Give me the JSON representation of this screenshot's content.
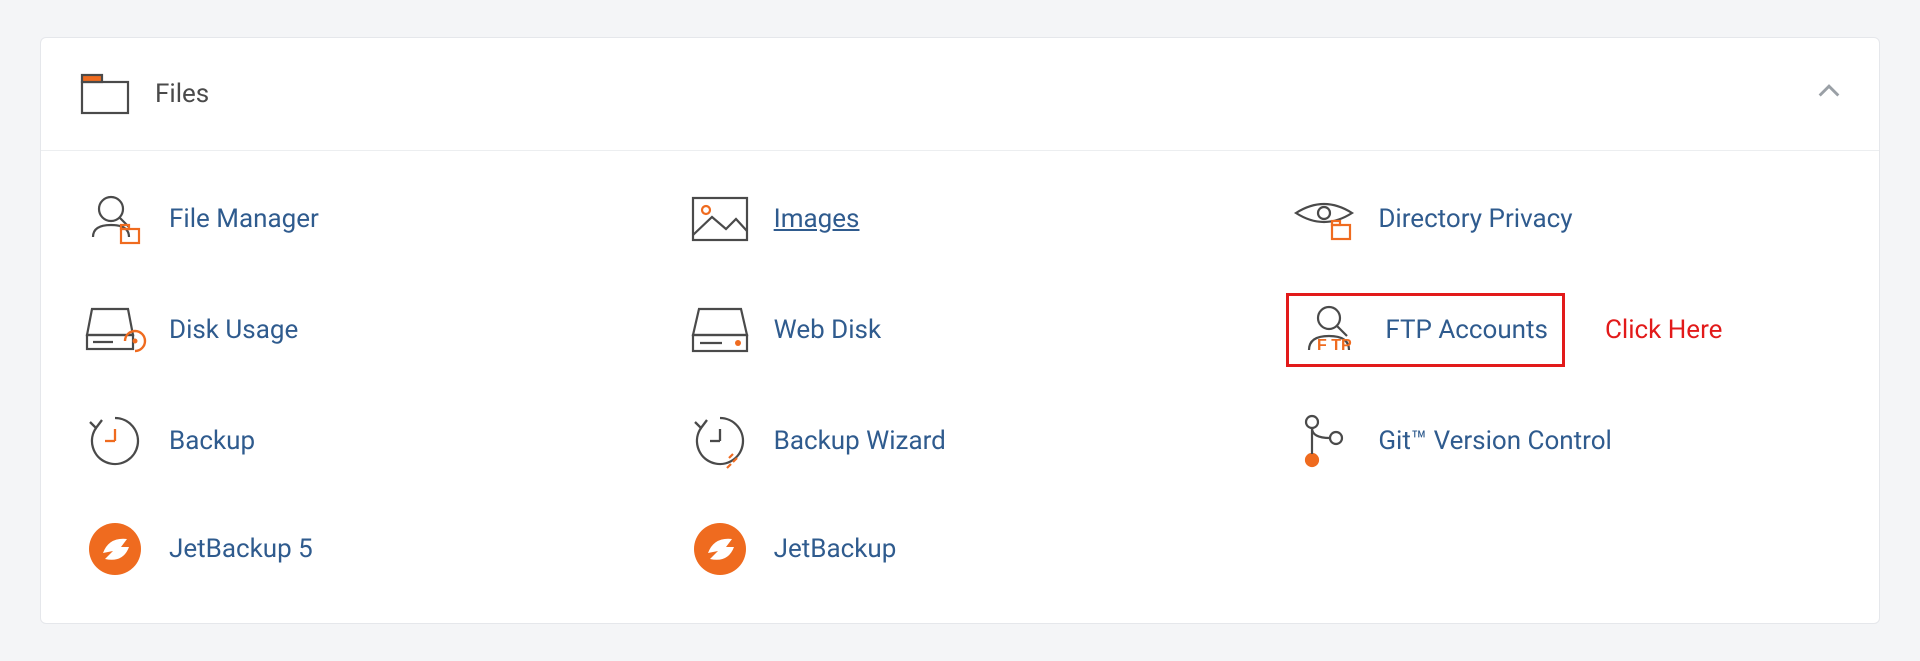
{
  "panel": {
    "title": "Files"
  },
  "items": {
    "file_manager": {
      "label": "File Manager",
      "highlighted": false,
      "underline": false
    },
    "images": {
      "label": "Images",
      "highlighted": false,
      "underline": true
    },
    "directory_privacy": {
      "label": "Directory Privacy",
      "highlighted": false,
      "underline": false
    },
    "disk_usage": {
      "label": "Disk Usage",
      "highlighted": false,
      "underline": false
    },
    "web_disk": {
      "label": "Web Disk",
      "highlighted": false,
      "underline": false
    },
    "ftp_accounts": {
      "label": "FTP Accounts",
      "highlighted": true,
      "underline": false
    },
    "backup": {
      "label": "Backup",
      "highlighted": false,
      "underline": false
    },
    "backup_wizard": {
      "label": "Backup Wizard",
      "highlighted": false,
      "underline": false
    },
    "git": {
      "label": "Git™ Version Control",
      "highlighted": false,
      "underline": false
    },
    "jetbackup5": {
      "label": "JetBackup 5",
      "highlighted": false,
      "underline": false
    },
    "jetbackup": {
      "label": "JetBackup",
      "highlighted": false,
      "underline": false
    }
  },
  "annotations": {
    "click_here": "Click Here"
  },
  "colors": {
    "link": "#2f5b8e",
    "accent": "#ef6b1f",
    "stroke": "#4a4a4a",
    "highlight": "#e21a1a"
  }
}
